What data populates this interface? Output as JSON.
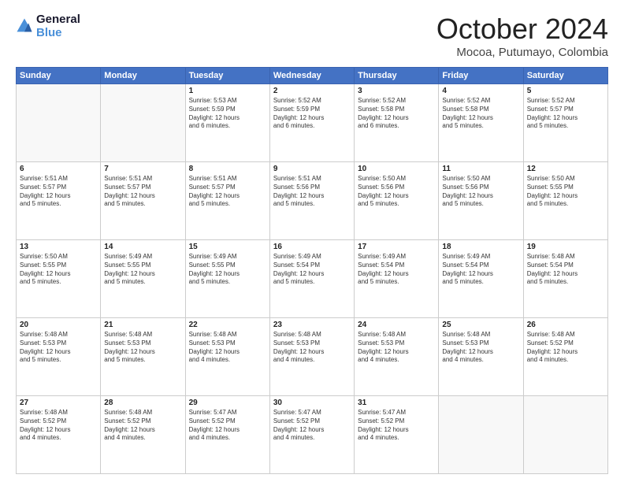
{
  "header": {
    "logo_line1": "General",
    "logo_line2": "Blue",
    "month": "October 2024",
    "location": "Mocoa, Putumayo, Colombia"
  },
  "weekdays": [
    "Sunday",
    "Monday",
    "Tuesday",
    "Wednesday",
    "Thursday",
    "Friday",
    "Saturday"
  ],
  "weeks": [
    [
      {
        "day": "",
        "info": ""
      },
      {
        "day": "",
        "info": ""
      },
      {
        "day": "1",
        "info": "Sunrise: 5:53 AM\nSunset: 5:59 PM\nDaylight: 12 hours\nand 6 minutes."
      },
      {
        "day": "2",
        "info": "Sunrise: 5:52 AM\nSunset: 5:59 PM\nDaylight: 12 hours\nand 6 minutes."
      },
      {
        "day": "3",
        "info": "Sunrise: 5:52 AM\nSunset: 5:58 PM\nDaylight: 12 hours\nand 6 minutes."
      },
      {
        "day": "4",
        "info": "Sunrise: 5:52 AM\nSunset: 5:58 PM\nDaylight: 12 hours\nand 5 minutes."
      },
      {
        "day": "5",
        "info": "Sunrise: 5:52 AM\nSunset: 5:57 PM\nDaylight: 12 hours\nand 5 minutes."
      }
    ],
    [
      {
        "day": "6",
        "info": "Sunrise: 5:51 AM\nSunset: 5:57 PM\nDaylight: 12 hours\nand 5 minutes."
      },
      {
        "day": "7",
        "info": "Sunrise: 5:51 AM\nSunset: 5:57 PM\nDaylight: 12 hours\nand 5 minutes."
      },
      {
        "day": "8",
        "info": "Sunrise: 5:51 AM\nSunset: 5:57 PM\nDaylight: 12 hours\nand 5 minutes."
      },
      {
        "day": "9",
        "info": "Sunrise: 5:51 AM\nSunset: 5:56 PM\nDaylight: 12 hours\nand 5 minutes."
      },
      {
        "day": "10",
        "info": "Sunrise: 5:50 AM\nSunset: 5:56 PM\nDaylight: 12 hours\nand 5 minutes."
      },
      {
        "day": "11",
        "info": "Sunrise: 5:50 AM\nSunset: 5:56 PM\nDaylight: 12 hours\nand 5 minutes."
      },
      {
        "day": "12",
        "info": "Sunrise: 5:50 AM\nSunset: 5:55 PM\nDaylight: 12 hours\nand 5 minutes."
      }
    ],
    [
      {
        "day": "13",
        "info": "Sunrise: 5:50 AM\nSunset: 5:55 PM\nDaylight: 12 hours\nand 5 minutes."
      },
      {
        "day": "14",
        "info": "Sunrise: 5:49 AM\nSunset: 5:55 PM\nDaylight: 12 hours\nand 5 minutes."
      },
      {
        "day": "15",
        "info": "Sunrise: 5:49 AM\nSunset: 5:55 PM\nDaylight: 12 hours\nand 5 minutes."
      },
      {
        "day": "16",
        "info": "Sunrise: 5:49 AM\nSunset: 5:54 PM\nDaylight: 12 hours\nand 5 minutes."
      },
      {
        "day": "17",
        "info": "Sunrise: 5:49 AM\nSunset: 5:54 PM\nDaylight: 12 hours\nand 5 minutes."
      },
      {
        "day": "18",
        "info": "Sunrise: 5:49 AM\nSunset: 5:54 PM\nDaylight: 12 hours\nand 5 minutes."
      },
      {
        "day": "19",
        "info": "Sunrise: 5:48 AM\nSunset: 5:54 PM\nDaylight: 12 hours\nand 5 minutes."
      }
    ],
    [
      {
        "day": "20",
        "info": "Sunrise: 5:48 AM\nSunset: 5:53 PM\nDaylight: 12 hours\nand 5 minutes."
      },
      {
        "day": "21",
        "info": "Sunrise: 5:48 AM\nSunset: 5:53 PM\nDaylight: 12 hours\nand 5 minutes."
      },
      {
        "day": "22",
        "info": "Sunrise: 5:48 AM\nSunset: 5:53 PM\nDaylight: 12 hours\nand 4 minutes."
      },
      {
        "day": "23",
        "info": "Sunrise: 5:48 AM\nSunset: 5:53 PM\nDaylight: 12 hours\nand 4 minutes."
      },
      {
        "day": "24",
        "info": "Sunrise: 5:48 AM\nSunset: 5:53 PM\nDaylight: 12 hours\nand 4 minutes."
      },
      {
        "day": "25",
        "info": "Sunrise: 5:48 AM\nSunset: 5:53 PM\nDaylight: 12 hours\nand 4 minutes."
      },
      {
        "day": "26",
        "info": "Sunrise: 5:48 AM\nSunset: 5:52 PM\nDaylight: 12 hours\nand 4 minutes."
      }
    ],
    [
      {
        "day": "27",
        "info": "Sunrise: 5:48 AM\nSunset: 5:52 PM\nDaylight: 12 hours\nand 4 minutes."
      },
      {
        "day": "28",
        "info": "Sunrise: 5:48 AM\nSunset: 5:52 PM\nDaylight: 12 hours\nand 4 minutes."
      },
      {
        "day": "29",
        "info": "Sunrise: 5:47 AM\nSunset: 5:52 PM\nDaylight: 12 hours\nand 4 minutes."
      },
      {
        "day": "30",
        "info": "Sunrise: 5:47 AM\nSunset: 5:52 PM\nDaylight: 12 hours\nand 4 minutes."
      },
      {
        "day": "31",
        "info": "Sunrise: 5:47 AM\nSunset: 5:52 PM\nDaylight: 12 hours\nand 4 minutes."
      },
      {
        "day": "",
        "info": ""
      },
      {
        "day": "",
        "info": ""
      }
    ]
  ]
}
